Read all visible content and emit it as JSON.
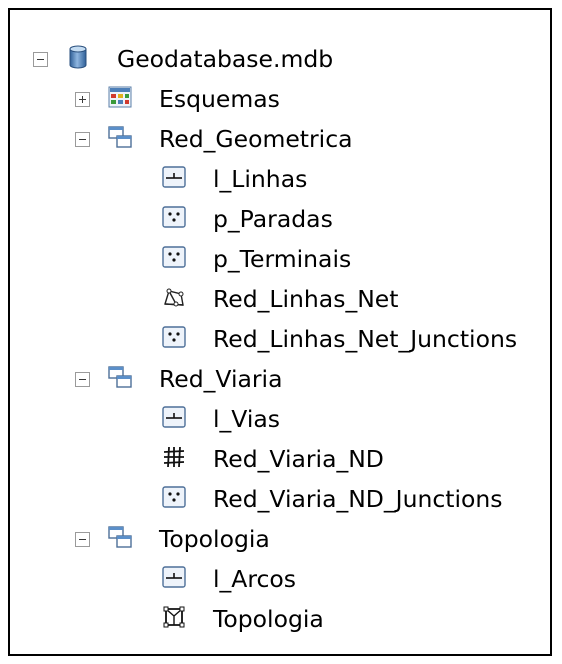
{
  "tree": {
    "root": {
      "label": "Geodatabase.mdb",
      "icon": "database-icon",
      "expanded": true
    },
    "esquemas": {
      "label": "Esquemas",
      "icon": "schematic-dataset-icon",
      "expanded": false
    },
    "red_geometrica": {
      "label": "Red_Geometrica",
      "icon": "feature-dataset-icon",
      "expanded": true,
      "children": [
        {
          "label": "l_Linhas",
          "icon": "line-feature-class-icon"
        },
        {
          "label": "p_Paradas",
          "icon": "point-feature-class-icon"
        },
        {
          "label": "p_Terminais",
          "icon": "point-feature-class-icon"
        },
        {
          "label": "Red_Linhas_Net",
          "icon": "geometric-network-icon"
        },
        {
          "label": "Red_Linhas_Net_Junctions",
          "icon": "point-feature-class-icon"
        }
      ]
    },
    "red_viaria": {
      "label": "Red_Viaria",
      "icon": "feature-dataset-icon",
      "expanded": true,
      "children": [
        {
          "label": "l_Vias",
          "icon": "line-feature-class-icon"
        },
        {
          "label": "Red_Viaria_ND",
          "icon": "network-dataset-icon"
        },
        {
          "label": "Red_Viaria_ND_Junctions",
          "icon": "point-feature-class-icon"
        }
      ]
    },
    "topologia": {
      "label": "Topologia",
      "icon": "feature-dataset-icon",
      "expanded": true,
      "children": [
        {
          "label": "l_Arcos",
          "icon": "line-feature-class-icon"
        },
        {
          "label": "Topologia",
          "icon": "topology-icon"
        }
      ]
    }
  },
  "colors": {
    "border": "#000000",
    "toggle_border": "#9a9a9a",
    "dataset_blue": "#5b8fc9",
    "database_blue": "#4d7fb8"
  }
}
